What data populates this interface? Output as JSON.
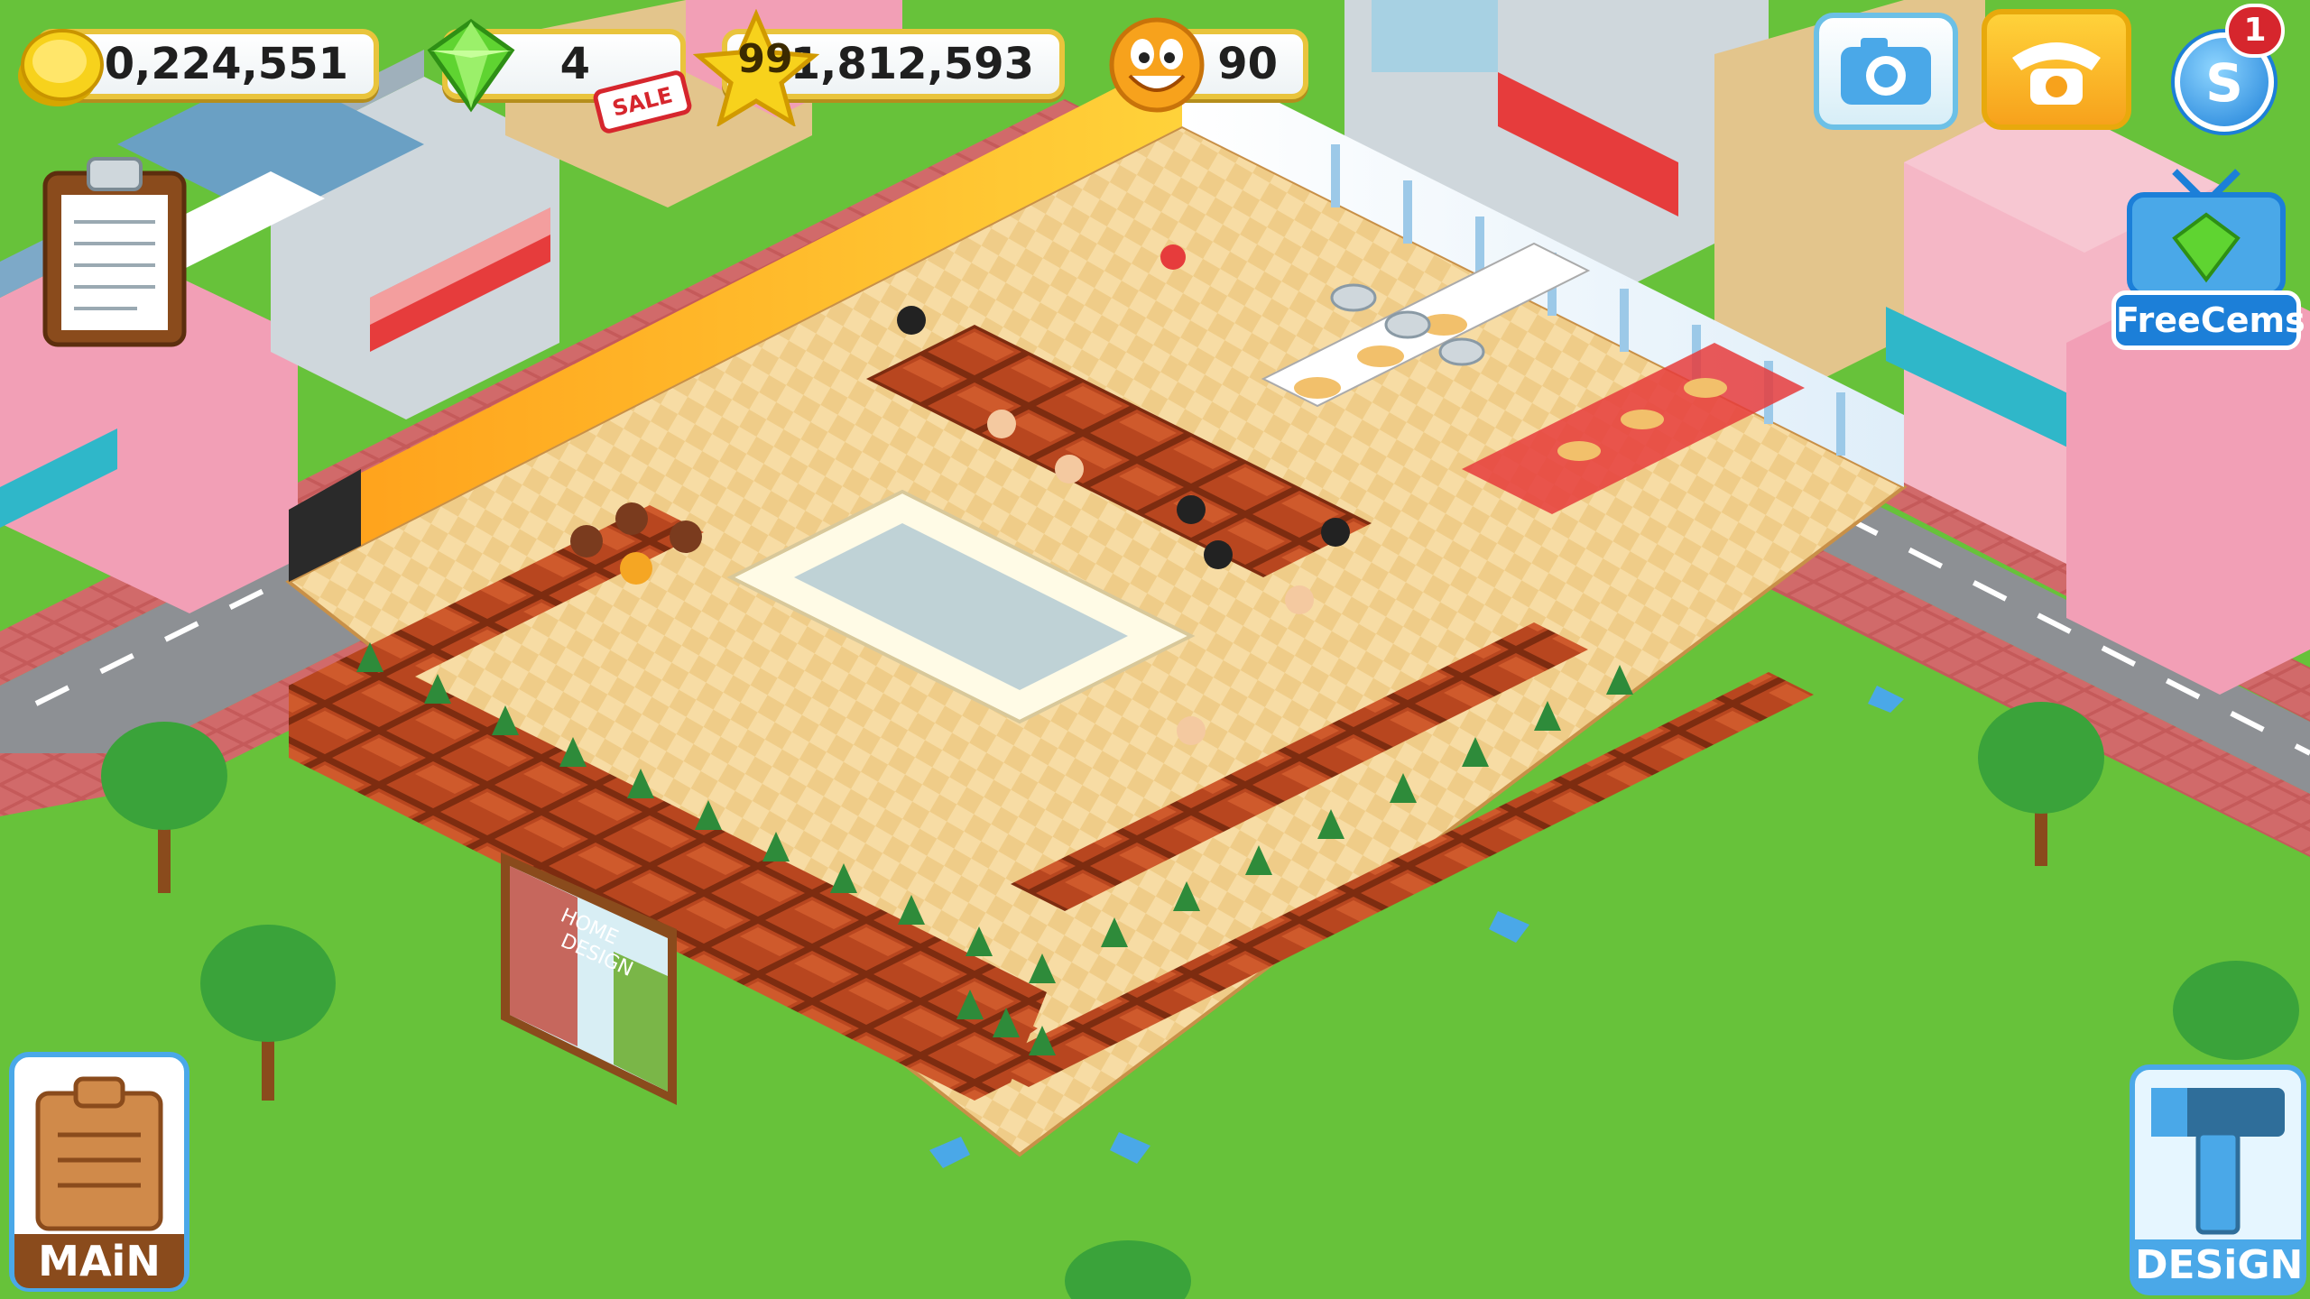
{
  "hud": {
    "coins": "30,224,551",
    "gems": "4",
    "gems_badge": "SALE",
    "level": "99",
    "experience": "1,812,593",
    "happiness": "90"
  },
  "top_right": {
    "notification_count": "1"
  },
  "free_gems": {
    "label": "FreeCems"
  },
  "bottom": {
    "main_label": "MAiN",
    "design_label": "DESiGN"
  },
  "billboard": {
    "line1": "HOME",
    "line2": "DESIGN"
  },
  "colors": {
    "grass": "#67c23a",
    "road": "#8c8f93",
    "sidewalk": "#c55a5a",
    "floor": "#f4d79a",
    "table_wood": "#b8461f",
    "hud_border": "#e9c43c",
    "accent_blue": "#1c7fd8"
  },
  "icons": [
    "coin-icon",
    "gem-icon",
    "star-icon",
    "smiley-icon",
    "camera-icon",
    "phone-icon",
    "social-icon",
    "clipboard-icon",
    "hammer-icon",
    "tv-icon"
  ]
}
